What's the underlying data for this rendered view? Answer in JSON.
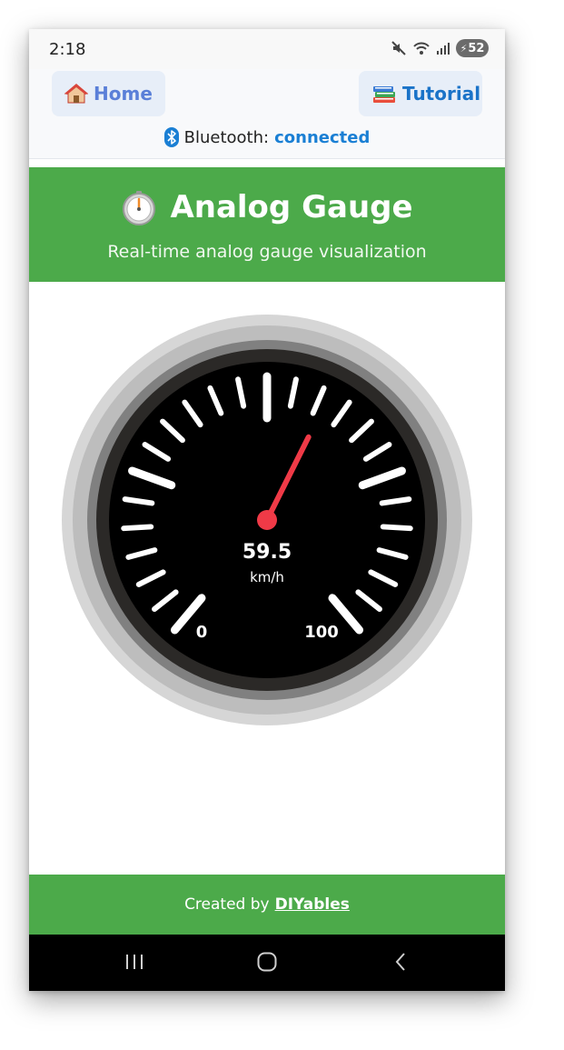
{
  "status_bar": {
    "time": "2:18",
    "battery": "52"
  },
  "nav": {
    "home_label": "Home",
    "tutorial_label": "Tutorial"
  },
  "bluetooth": {
    "label": "Bluetooth:",
    "state": "connected"
  },
  "header": {
    "title": "Analog Gauge",
    "subtitle": "Real-time analog gauge visualization"
  },
  "gauge": {
    "value": 59.5,
    "value_text": "59.5",
    "unit": "km/h",
    "min": 0,
    "max": 100,
    "min_label": "0",
    "max_label": "100"
  },
  "footer": {
    "prefix": "Created by",
    "brand": "DIYables"
  },
  "colors": {
    "header_green": "#4caa4a",
    "needle_red": "#f03a47",
    "link_blue": "#1a7fd4"
  }
}
